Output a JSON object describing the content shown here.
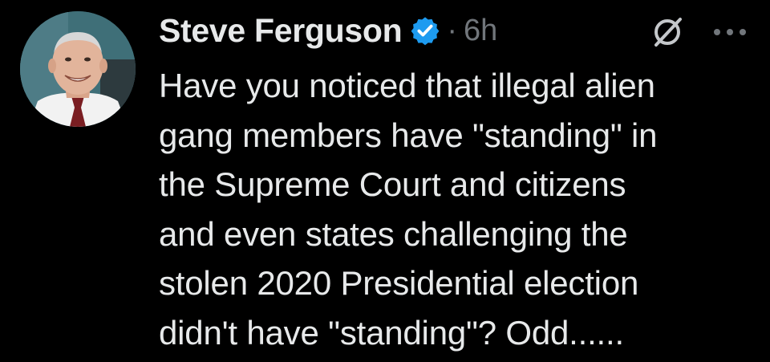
{
  "author": {
    "name": "Steve Ferguson",
    "verified_icon": "verified-badge-icon",
    "avatar_icon": "profile-photo"
  },
  "meta": {
    "separator": "·",
    "time": "6h"
  },
  "actions": {
    "grok_icon": "grok-icon",
    "more_icon": "more-options-icon"
  },
  "tweet": {
    "text": "Have you noticed that illegal alien\ngang members have \"standing\" in\nthe Supreme Court and citizens\nand even states challenging the\nstolen 2020 Presidential election\ndidn't have \"standing\"?  Odd......"
  },
  "colors": {
    "background": "#000000",
    "text": "#e7e9ea",
    "secondary": "#71767b",
    "verified_blue": "#1d9bf0"
  }
}
